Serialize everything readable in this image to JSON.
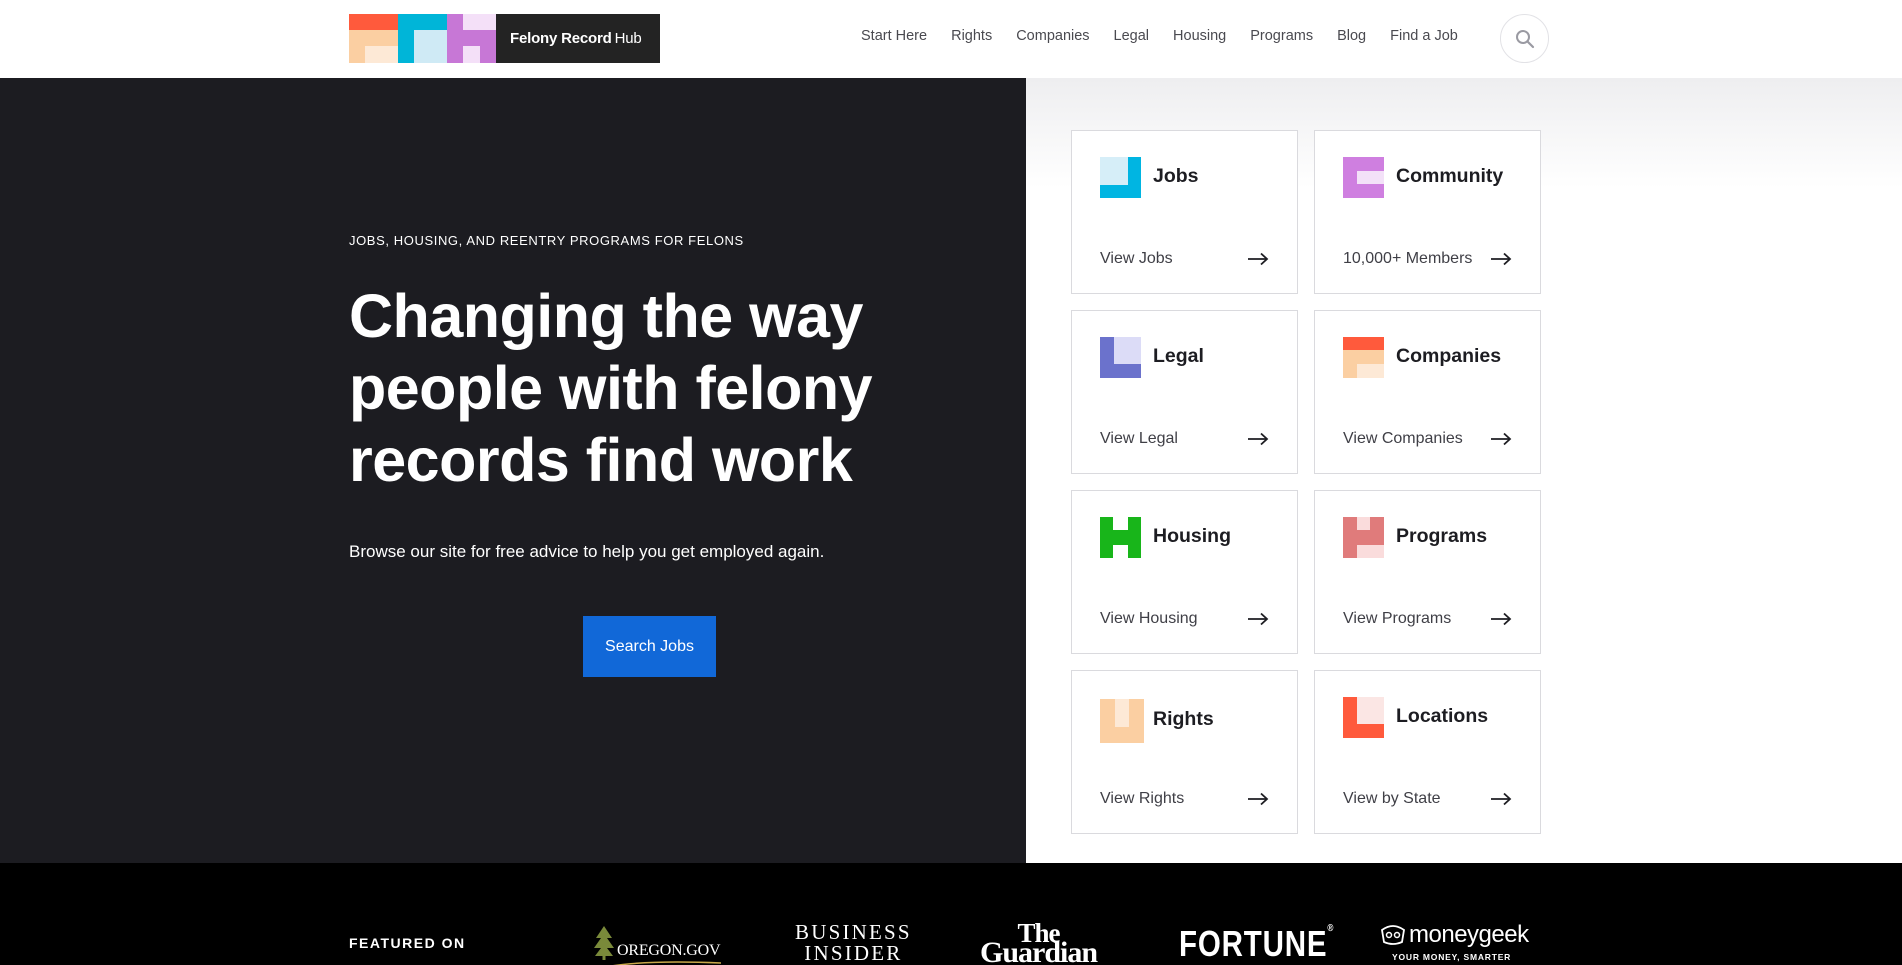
{
  "header": {
    "logo_name": "Felony Record Hub",
    "logo_bold": "Felony Record",
    "logo_thin": "Hub",
    "logo_colors": [
      "#ff5a3c",
      "#fbcfa2",
      "#fde9d6",
      "#00b5d8",
      "#cfeaf5",
      "#c777d6",
      "#f4e0f8"
    ],
    "nav": [
      "Start Here",
      "Rights",
      "Companies",
      "Legal",
      "Housing",
      "Programs",
      "Blog",
      "Find a Job"
    ],
    "search_icon": "search-icon"
  },
  "hero": {
    "eyebrow": "JOBS, HOUSING, AND REENTRY PROGRAMS FOR FELONS",
    "headline": "Changing the way people with felony records find work",
    "subtext": "Browse our site for free advice to help you get employed again.",
    "cta": "Search Jobs",
    "background": "#1c1c21",
    "cta_color": "#1168d8"
  },
  "cards": [
    {
      "title": "Jobs",
      "link": "View Jobs",
      "icon": "jobs-icon",
      "colors": [
        "#00b5e2",
        "#d6eef8"
      ]
    },
    {
      "title": "Community",
      "link": "10,000+ Members",
      "icon": "community-icon",
      "colors": [
        "#cf7fe0",
        "#f3e1f8"
      ]
    },
    {
      "title": "Legal",
      "link": "View Legal",
      "icon": "legal-icon",
      "colors": [
        "#6b72cc",
        "#dcdcf7"
      ]
    },
    {
      "title": "Companies",
      "link": "View Companies",
      "icon": "companies-icon",
      "colors": [
        "#ff5a3c",
        "#fbcfa2",
        "#fde9d6"
      ]
    },
    {
      "title": "Housing",
      "link": "View Housing",
      "icon": "housing-icon",
      "colors": [
        "#18b51a",
        "#ffffff"
      ]
    },
    {
      "title": "Programs",
      "link": "View Programs",
      "icon": "programs-icon",
      "colors": [
        "#e07b7b",
        "#fadcdc"
      ]
    },
    {
      "title": "Rights",
      "link": "View Rights",
      "icon": "rights-icon",
      "colors": [
        "#fbcfa2",
        "#fde9d6"
      ]
    },
    {
      "title": "Locations",
      "link": "View by State",
      "icon": "locations-icon",
      "colors": [
        "#ff5a3c",
        "#fbe6e4"
      ]
    }
  ],
  "featured": {
    "label": "FEATURED ON",
    "publications": [
      {
        "name": "OREGON.GOV",
        "icon": "tree-logo-icon"
      },
      {
        "line1": "BUSINESS",
        "line2": "INSIDER"
      },
      {
        "line1": "The",
        "line2": "Guardian"
      },
      {
        "name": "FORTUNE"
      },
      {
        "name": "moneygeek",
        "tagline": "YOUR MONEY, SMARTER",
        "icon": "moneygeek-logo-icon"
      }
    ]
  }
}
